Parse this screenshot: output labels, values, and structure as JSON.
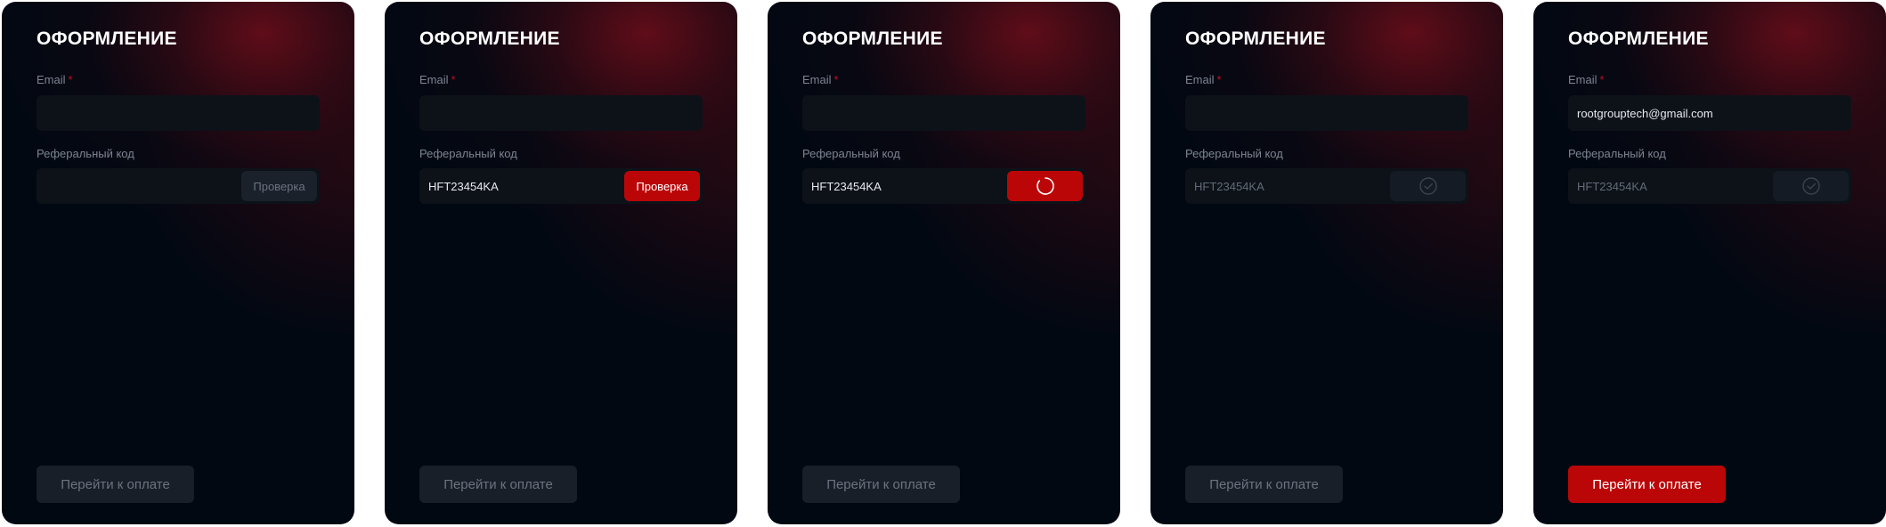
{
  "colors": {
    "card_background": "#020812",
    "glow": "#6e0e1a",
    "accent_red": "#bb0608",
    "field_background": "#0d1219",
    "label_gray": "#7d8491",
    "required_star": "#c0101e"
  },
  "form": {
    "title": "ОФОРМЛЕНИЕ",
    "email_label": "Email",
    "required_mark": "*",
    "referral_label": "Реферальный код",
    "check_label": "Проверка",
    "pay_label": "Перейти к оплате"
  },
  "states": [
    {
      "name": "empty",
      "email_value": "",
      "referral_value": "",
      "check_state": "inactive",
      "pay_state": "disabled"
    },
    {
      "name": "code-entered",
      "email_value": "",
      "referral_value": "HFT23454KA",
      "check_state": "active",
      "pay_state": "disabled"
    },
    {
      "name": "checking",
      "email_value": "",
      "referral_value": "HFT23454KA",
      "check_state": "loading",
      "check_icon": "spinner-icon",
      "pay_state": "disabled"
    },
    {
      "name": "code-verified",
      "email_value": "",
      "referral_value": "HFT23454KA",
      "check_state": "done",
      "check_icon": "check-circle-icon",
      "pay_state": "disabled"
    },
    {
      "name": "ready-to-pay",
      "email_value": "rootgrouptech@gmail.com",
      "referral_value": "HFT23454KA",
      "check_state": "done",
      "check_icon": "check-circle-icon",
      "pay_state": "enabled"
    }
  ]
}
